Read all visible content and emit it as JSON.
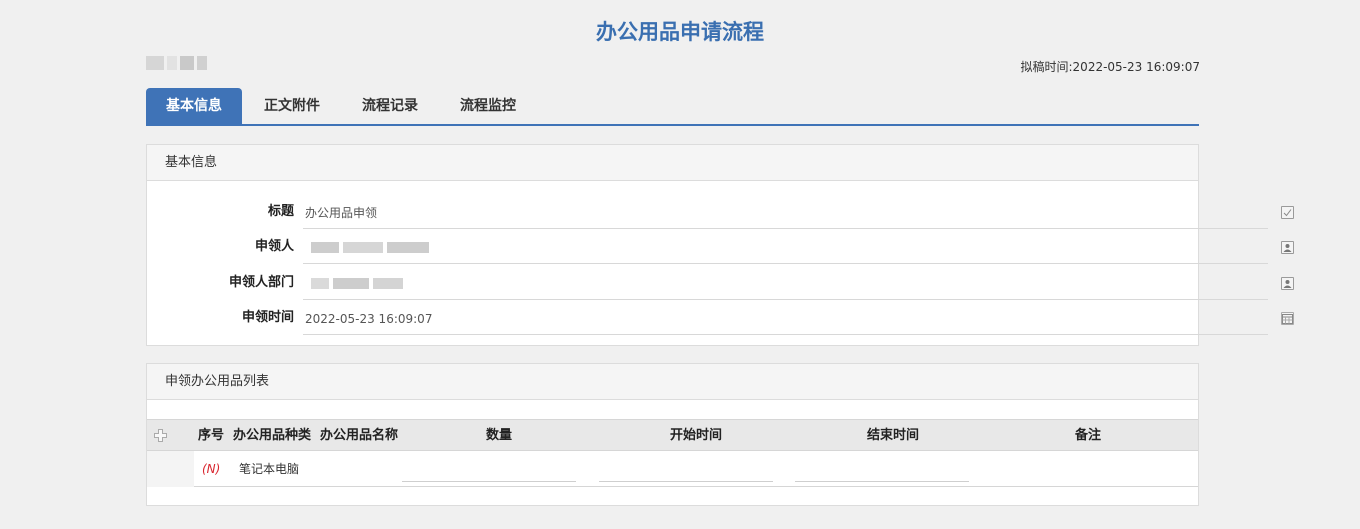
{
  "page": {
    "title": "办公用品申请流程",
    "draft_time_label": "拟稿时间:",
    "draft_time_value": "2022-05-23 16:09:07"
  },
  "tabs": [
    {
      "label": "基本信息",
      "active": true
    },
    {
      "label": "正文附件",
      "active": false
    },
    {
      "label": "流程记录",
      "active": false
    },
    {
      "label": "流程监控",
      "active": false
    }
  ],
  "basic_info": {
    "header": "基本信息",
    "fields": [
      {
        "label": "标题",
        "value": "办公用品申领",
        "icon": "edit-icon"
      },
      {
        "label": "申领人",
        "value": "",
        "icon": "user-picker-icon"
      },
      {
        "label": "申领人部门",
        "value": "",
        "icon": "user-picker-icon"
      },
      {
        "label": "申领时间",
        "value": "2022-05-23 16:09:07",
        "icon": "calendar-icon"
      }
    ]
  },
  "item_list": {
    "header": "申领办公用品列表",
    "columns": [
      "序号",
      "办公用品种类",
      "办公用品名称",
      "数量",
      "开始时间",
      "结束时间",
      "备注"
    ],
    "rows": [
      {
        "index": "(N)",
        "category": "笔记本电脑",
        "name": "",
        "quantity": "",
        "start": "",
        "end": "",
        "remark": ""
      }
    ]
  },
  "colors": {
    "accent": "#3f73b7",
    "title": "#3a6fb0",
    "row_index": "#d9262f"
  }
}
